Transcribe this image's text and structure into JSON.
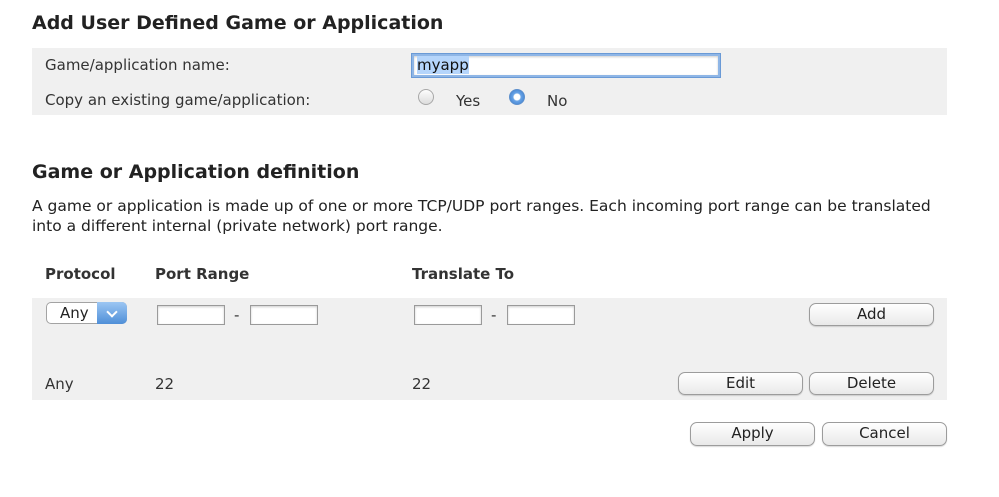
{
  "section1": {
    "title": "Add User Defined Game or Application",
    "name_label": "Game/application name:",
    "name_value": "myapp",
    "copy_label": "Copy an existing game/application:",
    "copy_options": [
      "Yes",
      "No"
    ],
    "copy_selected": "No"
  },
  "section2": {
    "title": "Game or Application definition",
    "description": "A game or application is made up of one or more TCP/UDP port ranges. Each incoming port range can be translated into a different internal (private network) port range.",
    "headers": {
      "protocol": "Protocol",
      "port_range": "Port Range",
      "translate_to": "Translate To"
    },
    "new_row": {
      "protocol_selected": "Any",
      "range_separator": "-",
      "add_label": "Add"
    },
    "rows": [
      {
        "protocol": "Any",
        "port_range": "22",
        "translate_to": "22",
        "edit_label": "Edit",
        "delete_label": "Delete"
      }
    ]
  },
  "footer": {
    "apply_label": "Apply",
    "cancel_label": "Cancel"
  },
  "colors": {
    "row_bg": "#f0f0f0",
    "accent_blue": "#4f8fd8",
    "selection": "#b5d5fb"
  }
}
